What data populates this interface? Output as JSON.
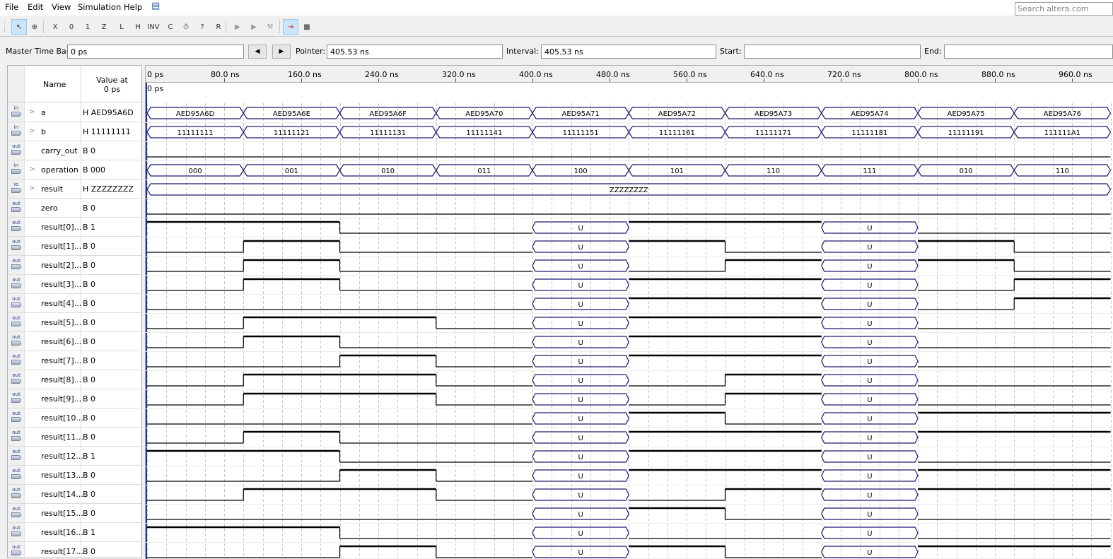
{
  "menubar": {
    "items": [
      "File",
      "Edit",
      "View",
      "Simulation",
      "Help"
    ],
    "feedback_icon": "speech-bubble-icon",
    "search_placeholder": "Search altera.com"
  },
  "toolbar": {
    "buttons": [
      {
        "name": "selection-tool",
        "glyph": "↖",
        "active": true
      },
      {
        "name": "zoom-tool",
        "glyph": "⊕",
        "active": false
      },
      {
        "name": "forcing-unknown",
        "glyph": "X",
        "active": false
      },
      {
        "name": "forcing-low-0",
        "glyph": "0",
        "active": false
      },
      {
        "name": "forcing-high-1",
        "glyph": "1",
        "active": false
      },
      {
        "name": "high-impedance-z",
        "glyph": "Z",
        "active": false
      },
      {
        "name": "weak-low-l",
        "glyph": "L",
        "active": false
      },
      {
        "name": "weak-high-h",
        "glyph": "H",
        "active": false
      },
      {
        "name": "invert",
        "glyph": "INV",
        "active": false
      },
      {
        "name": "count-value-c",
        "glyph": "C",
        "active": false
      },
      {
        "name": "overwrite-clock",
        "glyph": "⏱",
        "active": false
      },
      {
        "name": "arbitrary-value",
        "glyph": "?",
        "active": false
      },
      {
        "name": "random-values-r",
        "glyph": "R",
        "active": false
      },
      {
        "name": "run-functional-simulation",
        "glyph": "▶",
        "active": false
      },
      {
        "name": "run-timing-simulation",
        "glyph": "▶",
        "active": false
      },
      {
        "name": "generate-netlist",
        "glyph": "⚒",
        "active": false
      },
      {
        "name": "snap-to-grid",
        "glyph": "⇥",
        "active": true
      },
      {
        "name": "grid-settings",
        "glyph": "▦",
        "active": false
      }
    ]
  },
  "timebar": {
    "master_label": "Master Time Bar:",
    "master_value": "0 ps",
    "prev_label": "◀",
    "next_label": "▶",
    "pointer_label": "Pointer:",
    "pointer_value": "405.53 ns",
    "interval_label": "Interval:",
    "interval_value": "405.53 ns",
    "start_label": "Start:",
    "start_value": "",
    "end_label": "End:",
    "end_value": ""
  },
  "names_panel": {
    "header_name": "Name",
    "header_value_line1": "Value at",
    "header_value_line2": "0 ps"
  },
  "chart_data": {
    "type": "timing-diagram",
    "title": "",
    "x_unit": "ns",
    "xlim": [
      0,
      1000
    ],
    "tick_labels": [
      "0 ps",
      "80.0 ns",
      "160.0 ns",
      "240.0 ns",
      "320.0 ns",
      "400.0 ns",
      "480.0 ns",
      "560.0 ns",
      "640.0 ns",
      "720.0 ns",
      "800.0 ns",
      "880.0 ns",
      "960.0 ns"
    ],
    "tick_values": [
      0,
      80,
      160,
      240,
      320,
      400,
      480,
      560,
      640,
      720,
      800,
      880,
      960
    ],
    "cursor_label": "0 ps",
    "cursor_time": 0,
    "segment_boundaries": [
      0,
      100,
      200,
      300,
      400,
      500,
      600,
      700,
      800,
      900,
      1000
    ],
    "signals": [
      {
        "name": "a",
        "dir": "in",
        "bus": true,
        "value": "H AED95A6D",
        "segments": [
          "AED95A6D",
          "AED95A6E",
          "AED95A6F",
          "AED95A70",
          "AED95A71",
          "AED95A72",
          "AED95A73",
          "AED95A74",
          "AED95A75",
          "AED95A76"
        ]
      },
      {
        "name": "b",
        "dir": "in",
        "bus": true,
        "value": "H 11111111",
        "segments": [
          "11111111",
          "11111121",
          "11111131",
          "11111141",
          "11111151",
          "11111161",
          "11111171",
          "11111181",
          "11111191",
          "111111A1"
        ]
      },
      {
        "name": "carry_out",
        "dir": "out",
        "bus": false,
        "value": "B 0",
        "bits": "0000000000"
      },
      {
        "name": "operation",
        "dir": "in",
        "bus": true,
        "value": "B 000",
        "segments": [
          "000",
          "001",
          "010",
          "011",
          "100",
          "101",
          "110",
          "111",
          "010",
          "110"
        ]
      },
      {
        "name": "result",
        "dir": "io",
        "bus": true,
        "value": "H ZZZZZZZZ",
        "segments": [
          "ZZZZZZZZ"
        ]
      },
      {
        "name": "zero",
        "dir": "out",
        "bus": false,
        "value": "B 0",
        "bits": "0000000000"
      },
      {
        "name": "result[0]...",
        "dir": "out",
        "bus": false,
        "value": "B 1",
        "bits": "1100U11U00"
      },
      {
        "name": "result[1]...",
        "dir": "out",
        "bus": false,
        "value": "B 0",
        "bits": "0100U10U10"
      },
      {
        "name": "result[2]...",
        "dir": "out",
        "bus": false,
        "value": "B 0",
        "bits": "0100U01U10"
      },
      {
        "name": "result[3]...",
        "dir": "out",
        "bus": false,
        "value": "B 0",
        "bits": "0100U11U01"
      },
      {
        "name": "result[4]...",
        "dir": "out",
        "bus": false,
        "value": "B 0",
        "bits": "0000U11U01"
      },
      {
        "name": "result[5]...",
        "dir": "out",
        "bus": false,
        "value": "B 0",
        "bits": "0110U11U00"
      },
      {
        "name": "result[6]...",
        "dir": "out",
        "bus": false,
        "value": "B 0",
        "bits": "0100U11U00"
      },
      {
        "name": "result[7]...",
        "dir": "out",
        "bus": false,
        "value": "B 0",
        "bits": "0010U11U00"
      },
      {
        "name": "result[8]...",
        "dir": "out",
        "bus": false,
        "value": "B 0",
        "bits": "0110U01U00"
      },
      {
        "name": "result[9]...",
        "dir": "out",
        "bus": false,
        "value": "B 0",
        "bits": "0110U01U00"
      },
      {
        "name": "result[10...",
        "dir": "out",
        "bus": false,
        "value": "B 0",
        "bits": "0000U10U11"
      },
      {
        "name": "result[11...",
        "dir": "out",
        "bus": false,
        "value": "B 0",
        "bits": "0100U11U11"
      },
      {
        "name": "result[12...",
        "dir": "out",
        "bus": false,
        "value": "B 1",
        "bits": "1100U11U00"
      },
      {
        "name": "result[13...",
        "dir": "out",
        "bus": false,
        "value": "B 0",
        "bits": "0010U11U11"
      },
      {
        "name": "result[14...",
        "dir": "out",
        "bus": false,
        "value": "B 0",
        "bits": "0110U01U11"
      },
      {
        "name": "result[15...",
        "dir": "out",
        "bus": false,
        "value": "B 0",
        "bits": "0000U10U00"
      },
      {
        "name": "result[16...",
        "dir": "out",
        "bus": false,
        "value": "B 1",
        "bits": "1100U00U00"
      },
      {
        "name": "result[17...",
        "dir": "out",
        "bus": false,
        "value": "B 0",
        "bits": "0010U10U11"
      }
    ]
  }
}
